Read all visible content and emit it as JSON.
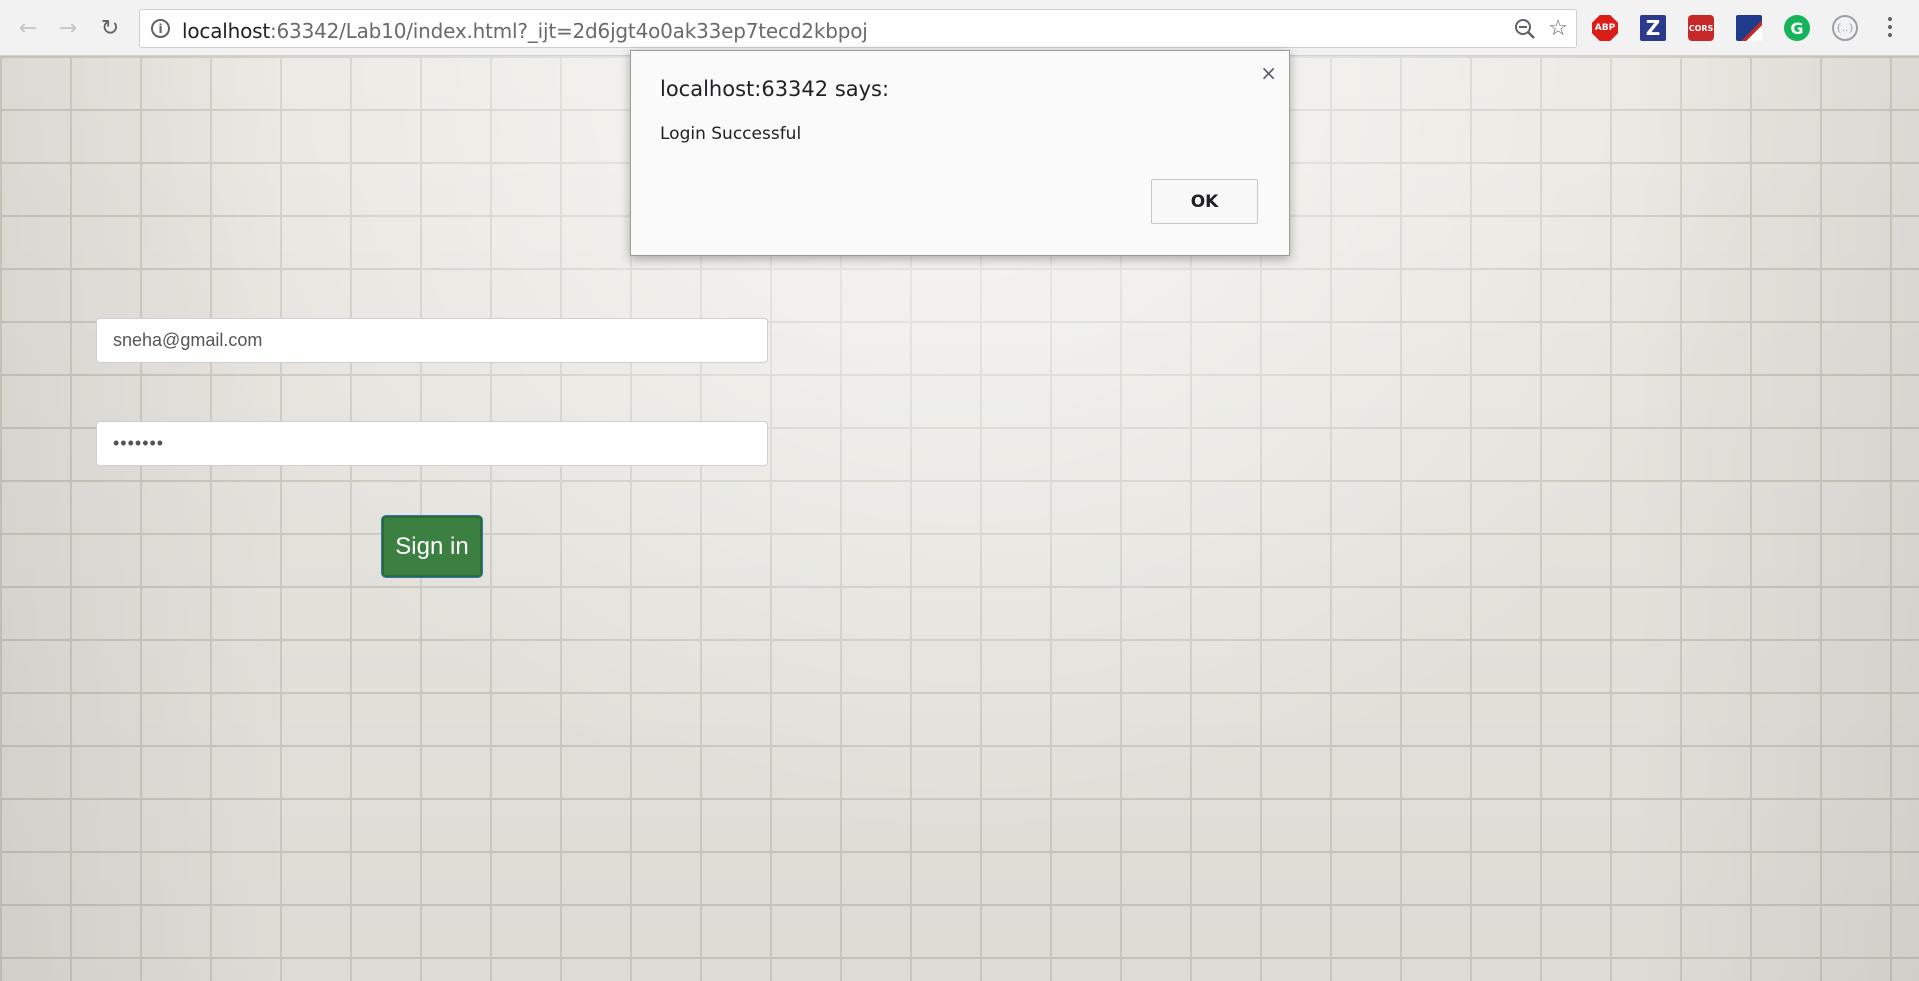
{
  "browser": {
    "url_host": "localhost",
    "url_rest": ":63342/Lab10/index.html?_ijt=2d6jgt4o0ak33ep7tecd2kbpoj",
    "icons": {
      "back": "back-arrow-icon",
      "forward": "forward-arrow-icon",
      "reload": "reload-icon",
      "info": "info-icon",
      "zoom": "zoom-out-icon",
      "star": "bookmark-star-icon",
      "menu": "kebab-menu-icon"
    },
    "extensions": {
      "abp": "ABP",
      "z": "Z",
      "cors": "CORS",
      "grammarly": "G",
      "code": "{..}"
    }
  },
  "form": {
    "email_value": "sneha@gmail.com",
    "password_value": "•••••••",
    "signin_label": "Sign in",
    "signin_color": "#3b8040"
  },
  "dialog": {
    "title": "localhost:63342 says:",
    "message": "Login Successful",
    "ok_label": "OK",
    "close_glyph": "×"
  }
}
